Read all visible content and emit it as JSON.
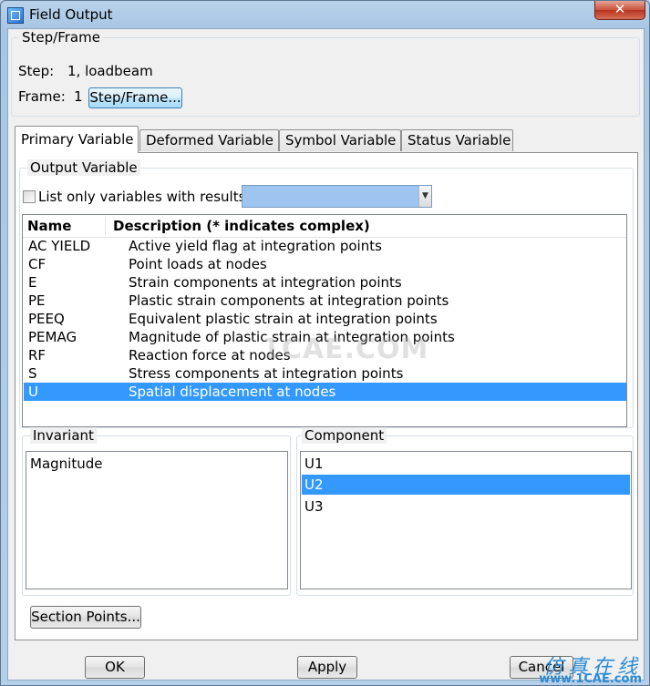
{
  "window": {
    "title": "Field Output",
    "close_glyph": "✕"
  },
  "step_frame": {
    "legend": "Step/Frame",
    "step_label": "Step:",
    "step_value": "1, loadbeam",
    "frame_label": "Frame:",
    "frame_value": "1",
    "button_label": "Step/Frame..."
  },
  "tabs": [
    {
      "label": "Primary Variable",
      "active": true
    },
    {
      "label": "Deformed Variable",
      "active": false
    },
    {
      "label": "Symbol Variable",
      "active": false
    },
    {
      "label": "Status Variable",
      "active": false
    }
  ],
  "output_variable": {
    "legend": "Output Variable",
    "filter_checkbox_label": "List only variables with results:",
    "filter_checked": false,
    "filter_combo_value": "",
    "columns": [
      "Name",
      "Description (* indicates complex)"
    ],
    "rows": [
      {
        "name": "AC YIELD",
        "description": "Active yield flag at integration points"
      },
      {
        "name": "CF",
        "description": "Point loads at nodes"
      },
      {
        "name": "E",
        "description": "Strain components at integration points"
      },
      {
        "name": "PE",
        "description": "Plastic strain components at integration points"
      },
      {
        "name": "PEEQ",
        "description": "Equivalent plastic strain at integration points"
      },
      {
        "name": "PEMAG",
        "description": "Magnitude of plastic strain at integration points"
      },
      {
        "name": "RF",
        "description": "Reaction force at nodes"
      },
      {
        "name": "S",
        "description": "Stress components at integration points"
      },
      {
        "name": "U",
        "description": "Spatial displacement at nodes"
      }
    ],
    "selected_row": "U"
  },
  "invariant": {
    "legend": "Invariant",
    "items": [
      "Magnitude"
    ]
  },
  "component": {
    "legend": "Component",
    "items": [
      "U1",
      "U2",
      "U3"
    ],
    "selected": "U2"
  },
  "section_points_label": "Section Points...",
  "footer": {
    "ok": "OK",
    "apply": "Apply",
    "cancel": "Cancel"
  },
  "watermark": {
    "center": "1CAE.COM",
    "brand_cn": "仿真在线",
    "brand_en": "www.1CAE.com"
  },
  "colors": {
    "selection": "#3399ff",
    "combo_fill": "#9ec5ef",
    "frame": "#b0cbe6"
  }
}
